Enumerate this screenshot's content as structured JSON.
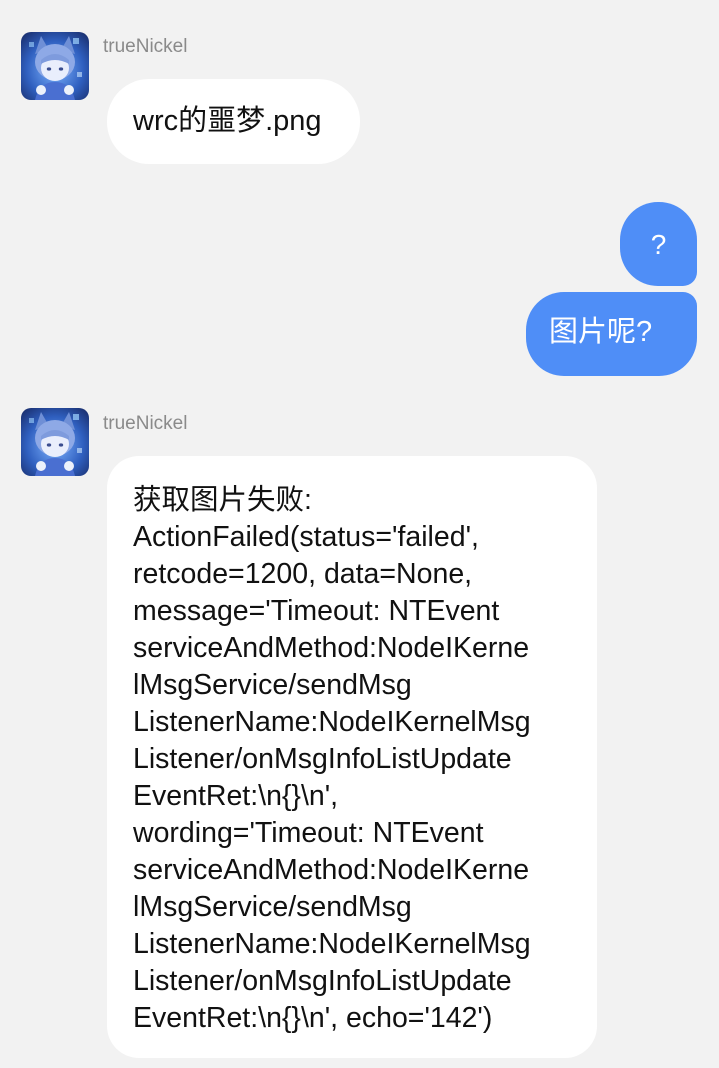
{
  "chat": {
    "messages": [
      {
        "direction": "incoming",
        "sender": "trueNickel",
        "text": "wrc的噩梦.png"
      },
      {
        "direction": "outgoing",
        "text": "?"
      },
      {
        "direction": "outgoing",
        "text": "图片呢?"
      },
      {
        "direction": "incoming",
        "sender": "trueNickel",
        "lines": [
          "获取图片失败:",
          "ActionFailed(status='failed',",
          "retcode=1200, data=None,",
          "message='Timeout: NTEvent",
          "serviceAndMethod:NodeIKerne",
          "lMsgService/sendMsg",
          "ListenerName:NodeIKernelMsg",
          "Listener/onMsgInfoListUpdate",
          "EventRet:\\n{}\\n',",
          "wording='Timeout: NTEvent",
          "serviceAndMethod:NodeIKerne",
          "lMsgService/sendMsg",
          "ListenerName:NodeIKernelMsg",
          "Listener/onMsgInfoListUpdate",
          "EventRet:\\n{}\\n', echo='142')"
        ]
      }
    ]
  },
  "colors": {
    "background": "#f2f2f2",
    "incoming_bubble": "#ffffff",
    "outgoing_bubble": "#4f8ef7",
    "sender_name": "#8a8a8a"
  },
  "icons": {
    "avatar": "anime-character-avatar"
  }
}
